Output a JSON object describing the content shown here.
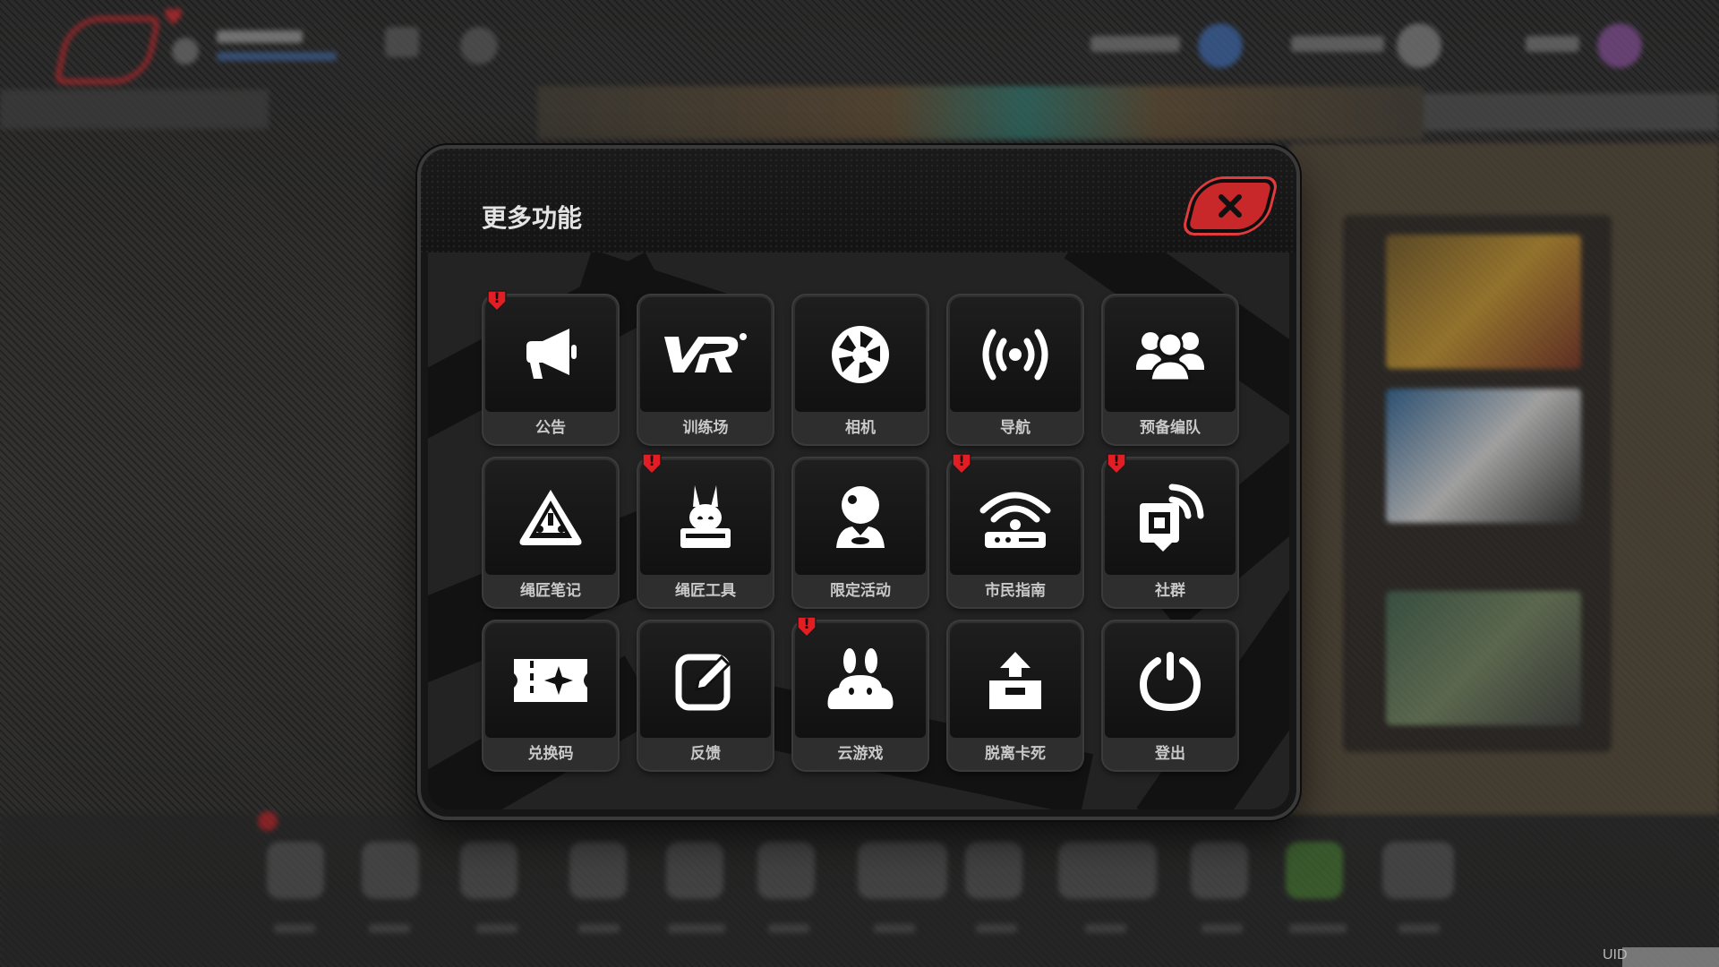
{
  "modal": {
    "title": "更多功能",
    "close_label": "关闭"
  },
  "colors": {
    "accent_red": "#c9282b",
    "badge_red": "#e01e24",
    "tile_label": "#c9c9c9"
  },
  "tiles": [
    {
      "label": "公告",
      "icon": "megaphone-icon",
      "badge": true
    },
    {
      "label": "训练场",
      "icon": "vr-logo-icon",
      "badge": false
    },
    {
      "label": "相机",
      "icon": "camera-aperture-icon",
      "badge": false
    },
    {
      "label": "导航",
      "icon": "broadcast-signal-icon",
      "badge": false
    },
    {
      "label": "预备编队",
      "icon": "team-group-icon",
      "badge": false
    },
    {
      "label": "绳匠笔记",
      "icon": "warning-triangle-icon",
      "badge": false
    },
    {
      "label": "绳匠工具",
      "icon": "bunny-box-icon",
      "badge": true
    },
    {
      "label": "限定活动",
      "icon": "figure-ball-icon",
      "badge": false
    },
    {
      "label": "市民指南",
      "icon": "wifi-router-icon",
      "badge": true
    },
    {
      "label": "社群",
      "icon": "community-share-icon",
      "badge": true
    },
    {
      "label": "兑换码",
      "icon": "ticket-icon",
      "badge": false
    },
    {
      "label": "反馈",
      "icon": "edit-pencil-icon",
      "badge": false
    },
    {
      "label": "云游戏",
      "icon": "cloud-bunny-icon",
      "badge": true
    },
    {
      "label": "脱离卡死",
      "icon": "upload-box-icon",
      "badge": false
    },
    {
      "label": "登出",
      "icon": "power-icon",
      "badge": false
    }
  ],
  "badge_symbol": "!",
  "footer": {
    "uid_label": "UID"
  }
}
